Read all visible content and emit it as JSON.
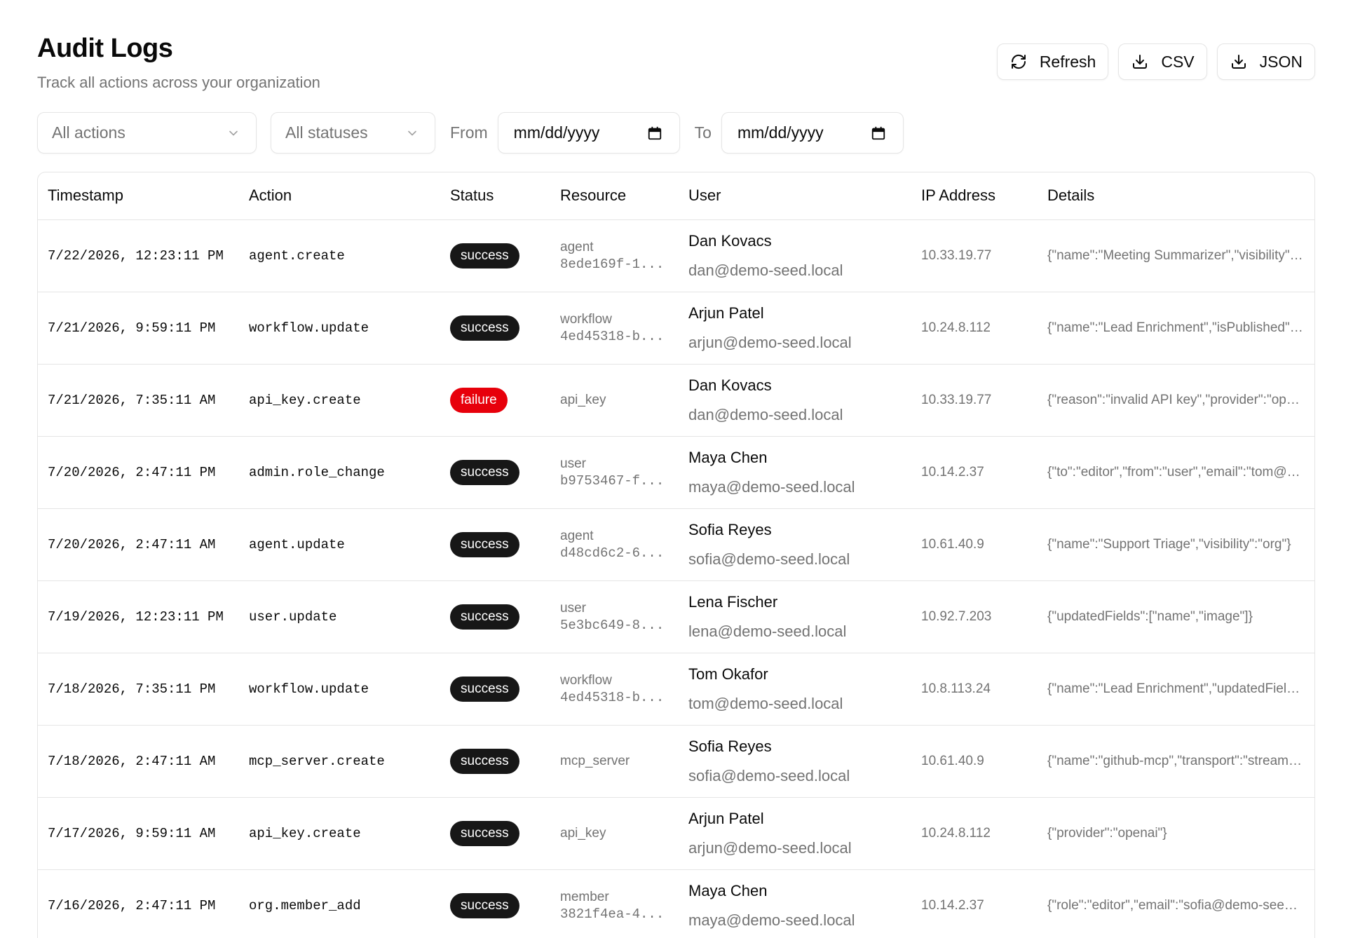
{
  "header": {
    "title": "Audit Logs",
    "subtitle": "Track all actions across your organization"
  },
  "toolbar": {
    "refresh_label": "Refresh",
    "csv_label": "CSV",
    "json_label": "JSON"
  },
  "filters": {
    "action_select": "All actions",
    "status_select": "All statuses",
    "from_label": "From",
    "from_value": "mm/dd/yyyy",
    "to_label": "To",
    "to_value": "mm/dd/yyyy"
  },
  "table": {
    "columns": [
      "Timestamp",
      "Action",
      "Status",
      "Resource",
      "User",
      "IP Address",
      "Details"
    ],
    "rows": [
      {
        "timestamp": "7/22/2026, 12:23:11 PM",
        "action": "agent.create",
        "status": "success",
        "resource_type": "agent",
        "resource_id": "8ede169f-1...",
        "user_name": "Dan Kovacs",
        "user_email": "dan@demo-seed.local",
        "ip": "10.33.19.77",
        "details": "{\"name\":\"Meeting Summarizer\",\"visibility\":\"org\"}"
      },
      {
        "timestamp": "7/21/2026, 9:59:11 PM",
        "action": "workflow.update",
        "status": "success",
        "resource_type": "workflow",
        "resource_id": "4ed45318-b...",
        "user_name": "Arjun Patel",
        "user_email": "arjun@demo-seed.local",
        "ip": "10.24.8.112",
        "details": "{\"name\":\"Lead Enrichment\",\"isPublished\":true}"
      },
      {
        "timestamp": "7/21/2026, 7:35:11 AM",
        "action": "api_key.create",
        "status": "failure",
        "resource_type": "api_key",
        "resource_id": "",
        "user_name": "Dan Kovacs",
        "user_email": "dan@demo-seed.local",
        "ip": "10.33.19.77",
        "details": "{\"reason\":\"invalid API key\",\"provider\":\"openai\"}"
      },
      {
        "timestamp": "7/20/2026, 2:47:11 PM",
        "action": "admin.role_change",
        "status": "success",
        "resource_type": "user",
        "resource_id": "b9753467-f...",
        "user_name": "Maya Chen",
        "user_email": "maya@demo-seed.local",
        "ip": "10.14.2.37",
        "details": "{\"to\":\"editor\",\"from\":\"user\",\"email\":\"tom@demo-seed.local\"}"
      },
      {
        "timestamp": "7/20/2026, 2:47:11 AM",
        "action": "agent.update",
        "status": "success",
        "resource_type": "agent",
        "resource_id": "d48cd6c2-6...",
        "user_name": "Sofia Reyes",
        "user_email": "sofia@demo-seed.local",
        "ip": "10.61.40.9",
        "details": "{\"name\":\"Support Triage\",\"visibility\":\"org\"}"
      },
      {
        "timestamp": "7/19/2026, 12:23:11 PM",
        "action": "user.update",
        "status": "success",
        "resource_type": "user",
        "resource_id": "5e3bc649-8...",
        "user_name": "Lena Fischer",
        "user_email": "lena@demo-seed.local",
        "ip": "10.92.7.203",
        "details": "{\"updatedFields\":[\"name\",\"image\"]}"
      },
      {
        "timestamp": "7/18/2026, 7:35:11 PM",
        "action": "workflow.update",
        "status": "success",
        "resource_type": "workflow",
        "resource_id": "4ed45318-b...",
        "user_name": "Tom Okafor",
        "user_email": "tom@demo-seed.local",
        "ip": "10.8.113.24",
        "details": "{\"name\":\"Lead Enrichment\",\"updatedFields\":[\"nodes\"]}"
      },
      {
        "timestamp": "7/18/2026, 2:47:11 AM",
        "action": "mcp_server.create",
        "status": "success",
        "resource_type": "mcp_server",
        "resource_id": "",
        "user_name": "Sofia Reyes",
        "user_email": "sofia@demo-seed.local",
        "ip": "10.61.40.9",
        "details": "{\"name\":\"github-mcp\",\"transport\":\"streamable-http\"}"
      },
      {
        "timestamp": "7/17/2026, 9:59:11 AM",
        "action": "api_key.create",
        "status": "success",
        "resource_type": "api_key",
        "resource_id": "",
        "user_name": "Arjun Patel",
        "user_email": "arjun@demo-seed.local",
        "ip": "10.24.8.112",
        "details": "{\"provider\":\"openai\"}"
      },
      {
        "timestamp": "7/16/2026, 2:47:11 PM",
        "action": "org.member_add",
        "status": "success",
        "resource_type": "member",
        "resource_id": "3821f4ea-4...",
        "user_name": "Maya Chen",
        "user_email": "maya@demo-seed.local",
        "ip": "10.14.2.37",
        "details": "{\"role\":\"editor\",\"email\":\"sofia@demo-seed.local\"}"
      }
    ]
  },
  "colors": {
    "success_badge": "#171717",
    "failure_badge": "#e7000b",
    "muted_text": "#737373",
    "border": "#e5e5e5"
  },
  "icons": {
    "refresh": "refresh-icon",
    "download": "download-icon",
    "chevron": "chevron-down-icon",
    "calendar": "calendar-icon"
  }
}
